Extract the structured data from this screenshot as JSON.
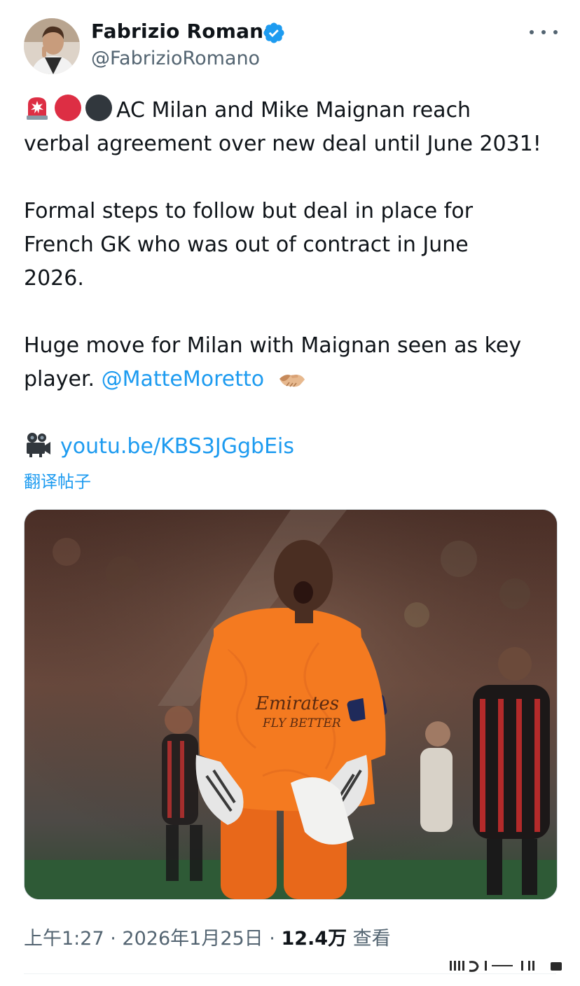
{
  "author": {
    "display_name": "Fabrizio Romano",
    "handle": "@FabrizioRomano",
    "verified": true,
    "avatar_icon": "profile-photo"
  },
  "tweet": {
    "line1_text": "AC Milan and Mike Maignan reach",
    "line2_text": "verbal agreement over new deal until June 2031!",
    "para2_line1": "Formal steps to follow but deal in place for",
    "para2_line2": "French GK who was out of contract in June",
    "para2_line3": "2026.",
    "para3_line1": "Huge move for Milan with Maignan seen as key",
    "para3_line2_prefix": "player.",
    "mention": "@MatteMoretto",
    "link": "youtu.be/KBS3JGgbEis",
    "leading_emojis": [
      "siren-icon",
      "red-circle-icon",
      "black-circle-icon"
    ],
    "trailing_emoji": "handshake-icon",
    "link_emoji": "movie-camera-icon"
  },
  "translate_label": "翻译帖子",
  "meta": {
    "time": "上午1:27",
    "date": "2026年1月25日",
    "views_count": "12.4万",
    "views_label": "查看",
    "separator": "·"
  },
  "colors": {
    "link_blue": "#1d9bf0",
    "secondary_text": "#536471",
    "verified_blue": "#1d9bf0",
    "jersey_orange": "#f47a20"
  }
}
